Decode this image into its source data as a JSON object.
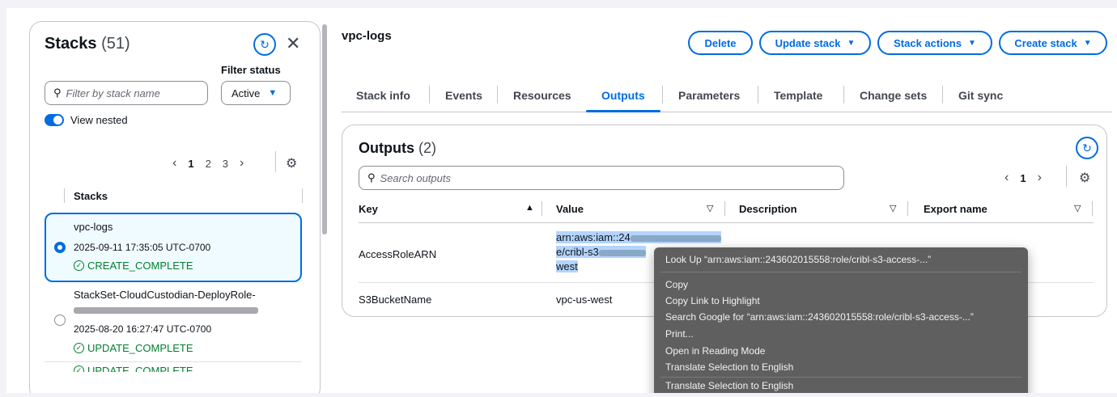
{
  "left_panel": {
    "title": "Stacks",
    "count": "(51)",
    "filter_status_label": "Filter status",
    "search_placeholder": "Filter by stack name",
    "status_select": "Active",
    "view_nested": "View nested",
    "pages": [
      "1",
      "2",
      "3"
    ],
    "current_page": "1",
    "column_header": "Stacks",
    "stacks": [
      {
        "name": "vpc-logs",
        "time": "2025-09-11 17:35:05 UTC-0700",
        "status": "CREATE_COMPLETE",
        "selected": true
      },
      {
        "name": "StackSet-CloudCustodian-DeployRole-",
        "time": "2025-08-20 16:27:47 UTC-0700",
        "status": "UPDATE_COMPLETE",
        "selected": false
      },
      {
        "status": "UPDATE_COMPLETE"
      }
    ]
  },
  "header": {
    "title": "vpc-logs",
    "buttons": {
      "delete": "Delete",
      "update": "Update stack",
      "actions": "Stack actions",
      "create": "Create stack"
    }
  },
  "tabs": [
    "Stack info",
    "Events",
    "Resources",
    "Outputs",
    "Parameters",
    "Template",
    "Change sets",
    "Git sync"
  ],
  "active_tab": "Outputs",
  "outputs": {
    "title": "Outputs",
    "count": "(2)",
    "search_placeholder": "Search outputs",
    "page": "1",
    "columns": {
      "key": "Key",
      "value": "Value",
      "description": "Description",
      "export": "Export name"
    },
    "rows": [
      {
        "key": "AccessRoleARN",
        "value_line1": "arn:aws:iam::24",
        "value_line2": "e/cribl-s3",
        "value_line3": "west"
      },
      {
        "key": "S3BucketName",
        "value": "vpc-us-west"
      }
    ]
  },
  "context_menu": {
    "lookup": "Look Up “arn:aws:iam::243602015558:role/cribl-s3-access-...”",
    "items": [
      "Copy",
      "Copy Link to Highlight",
      "Search Google for “arn:aws:iam::243602015558:role/cribl-s3-access-...”",
      "Print...",
      "Open in Reading Mode",
      "Translate Selection to English",
      "Translate Selection to English"
    ]
  },
  "colors": {
    "accent": "#006ce0",
    "success": "#00802f",
    "menu_bg": "#5f5f5f"
  }
}
